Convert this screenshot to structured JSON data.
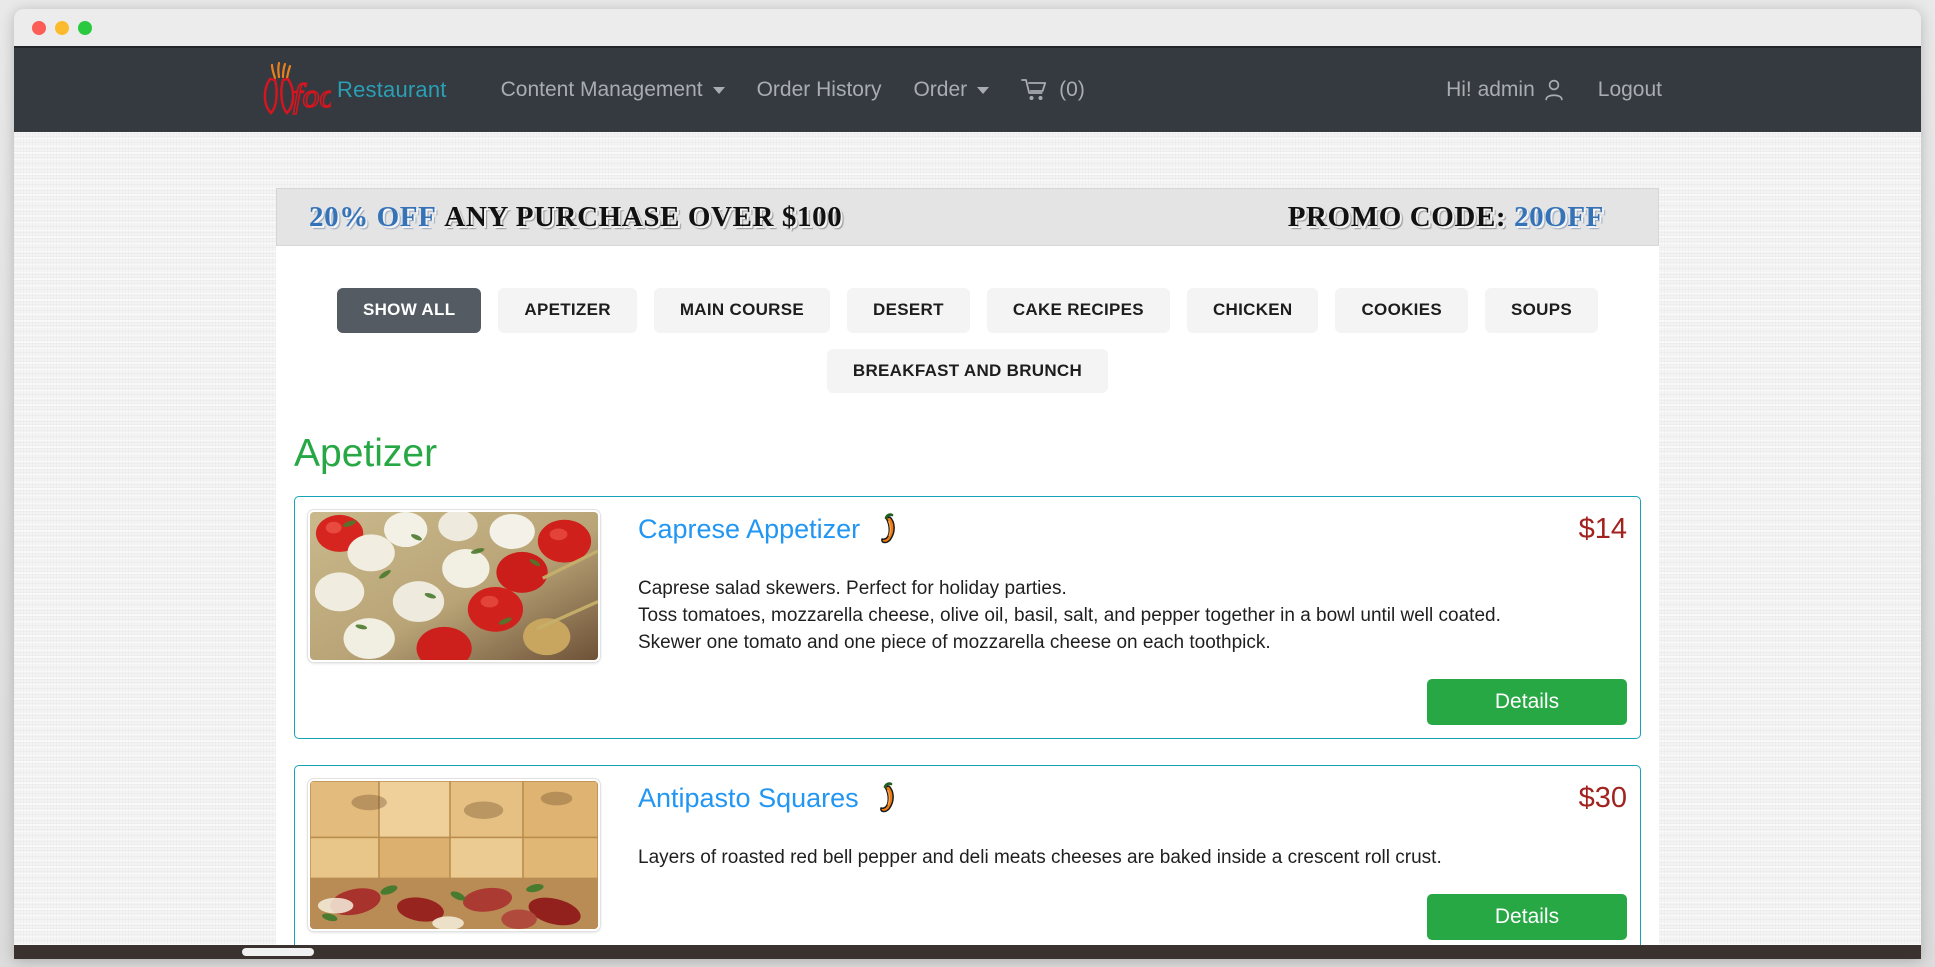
{
  "window": {
    "traffic_lights": [
      "close",
      "minimize",
      "zoom"
    ]
  },
  "navbar": {
    "brand_name": "foods",
    "brand_sub": "Restaurant",
    "links": [
      {
        "label": "Content Management",
        "has_caret": true
      },
      {
        "label": "Order History",
        "has_caret": false
      },
      {
        "label": "Order",
        "has_caret": true
      }
    ],
    "cart": {
      "icon": "shopping-cart-icon",
      "count_label": "(0)"
    },
    "user_greeting": "Hi! admin",
    "user_icon": "user-icon",
    "logout_label": "Logout"
  },
  "promo": {
    "highlight": "20% OFF",
    "text": "ANY PURCHASE OVER $100",
    "code_label": "PROMO CODE:",
    "code": "20OFF",
    "highlight_color": "#3573b9"
  },
  "filters": {
    "items": [
      {
        "label": "SHOW ALL",
        "active": true
      },
      {
        "label": "APETIZER",
        "active": false
      },
      {
        "label": "MAIN COURSE",
        "active": false
      },
      {
        "label": "DESERT",
        "active": false
      },
      {
        "label": "CAKE RECIPES",
        "active": false
      },
      {
        "label": "CHICKEN",
        "active": false
      },
      {
        "label": "COOKIES",
        "active": false
      },
      {
        "label": "SOUPS",
        "active": false
      },
      {
        "label": "BREAKFAST AND BRUNCH",
        "active": false
      }
    ],
    "active_bg": "#545b62",
    "inactive_bg": "#f4f4f5"
  },
  "section": {
    "heading": "Apetizer",
    "heading_color": "#28a745"
  },
  "items": [
    {
      "title": "Caprese Appetizer",
      "spicy_icon": "chili-pepper-icon",
      "price": "$14",
      "description_lines": [
        "Caprese salad skewers. Perfect for holiday parties.",
        "Toss tomatoes, mozzarella cheese, olive oil, basil, salt, and pepper together in a bowl until well coated.",
        "Skewer one tomato and one piece of mozzarella cheese on each toothpick."
      ],
      "details_label": "Details",
      "image_alt": "caprese-salad-skewers-photo"
    },
    {
      "title": "Antipasto Squares",
      "spicy_icon": "chili-pepper-icon",
      "price": "$30",
      "description_lines": [
        "Layers of roasted red bell pepper and deli meats cheeses are baked inside a crescent roll crust."
      ],
      "details_label": "Details",
      "image_alt": "antipasto-squares-photo"
    }
  ],
  "theme": {
    "navbar_bg": "#343a40",
    "card_border": "#17a2b8",
    "title_color": "#2196f3",
    "price_color": "#a1221f",
    "details_bg": "#28a745"
  }
}
